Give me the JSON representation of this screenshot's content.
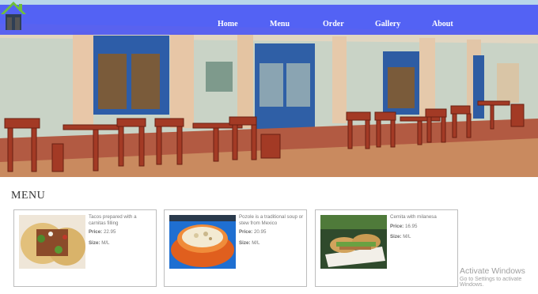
{
  "nav": {
    "logo_icon": "house-icon",
    "items": [
      {
        "label": "Home"
      },
      {
        "label": "Menu"
      },
      {
        "label": "Order"
      },
      {
        "label": "Gallery"
      },
      {
        "label": "About"
      }
    ]
  },
  "menu": {
    "title": "MENU",
    "cards": [
      {
        "description": "Tacos prepared with a carnitas filling",
        "price_label": "Price:",
        "price": "22.95",
        "size_label": "Size:",
        "size": "M/L",
        "image_icon": "tacos-photo"
      },
      {
        "description": "Pozole is a traditional soup or stew from Mexico",
        "price_label": "Price:",
        "price": "20.95",
        "size_label": "Size:",
        "size": "M/L",
        "image_icon": "pozole-photo"
      },
      {
        "description": "Cemita with milanesa",
        "price_label": "Price:",
        "price": "16.95",
        "size_label": "Size:",
        "size": "M/L",
        "image_icon": "cemita-photo"
      }
    ]
  },
  "watermark": {
    "line1": "Activate Windows",
    "line2": "Go to Settings to activate Windows."
  },
  "colors": {
    "navbar": "#4652f5",
    "border": "#bdbdbd"
  }
}
